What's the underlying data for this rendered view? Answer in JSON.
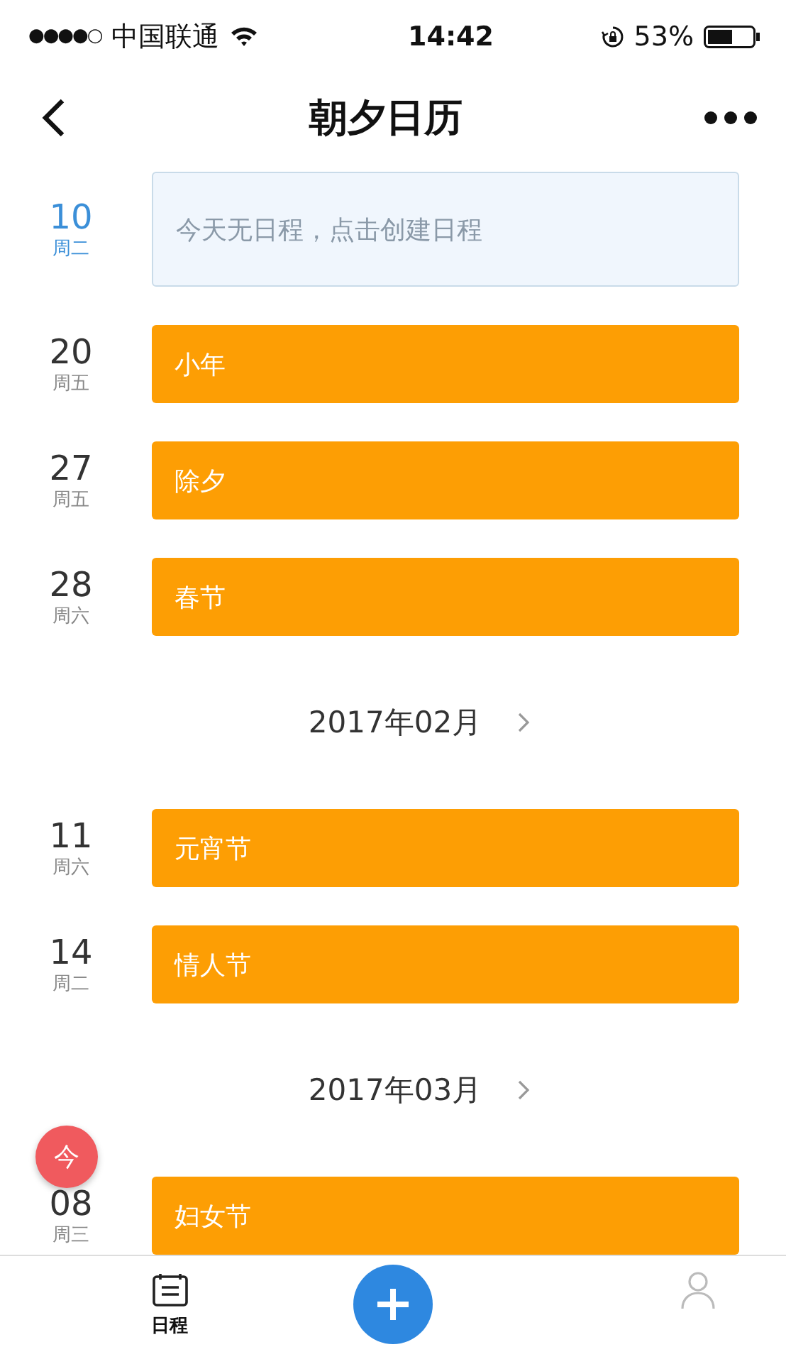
{
  "status_bar": {
    "signal_dots": "●●●●○",
    "carrier": "中国联通",
    "time": "14:42",
    "battery": "53%"
  },
  "nav": {
    "title": "朝夕日历"
  },
  "agenda": [
    {
      "kind": "empty",
      "day": "10",
      "weekday": "周二",
      "today": true,
      "text": "今天无日程，点击创建日程"
    },
    {
      "kind": "event",
      "day": "20",
      "weekday": "周五",
      "today": false,
      "text": "小年"
    },
    {
      "kind": "event",
      "day": "27",
      "weekday": "周五",
      "today": false,
      "text": "除夕"
    },
    {
      "kind": "event",
      "day": "28",
      "weekday": "周六",
      "today": false,
      "text": "春节"
    },
    {
      "kind": "month",
      "text": "2017年02月"
    },
    {
      "kind": "event",
      "day": "11",
      "weekday": "周六",
      "today": false,
      "text": "元宵节"
    },
    {
      "kind": "event",
      "day": "14",
      "weekday": "周二",
      "today": false,
      "text": "情人节"
    },
    {
      "kind": "month",
      "text": "2017年03月"
    },
    {
      "kind": "event",
      "day": "08",
      "weekday": "周三",
      "today": false,
      "text": "妇女节"
    }
  ],
  "today_button": "今",
  "tab_bar": {
    "tabs": [
      {
        "kind": "schedule",
        "label": "日程",
        "selected": true
      },
      {
        "kind": "add"
      },
      {
        "kind": "profile"
      }
    ]
  }
}
